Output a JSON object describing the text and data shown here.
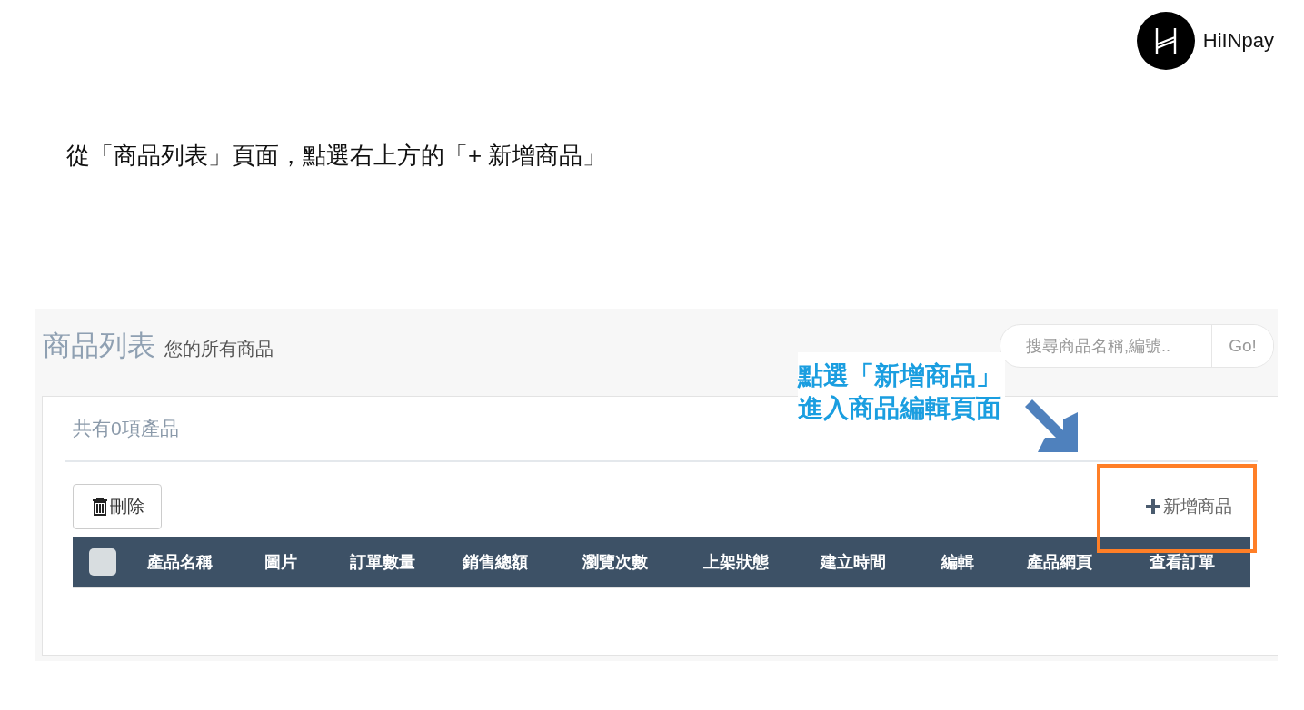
{
  "logo": {
    "text": "HiINpay"
  },
  "caption": "從「商品列表」頁面，點選右上方的「+ 新增商品」",
  "screenshot": {
    "title": "商品列表",
    "subtitle": "您的所有商品",
    "search": {
      "placeholder": "搜尋商品名稱,編號..",
      "button": "Go!"
    },
    "count": "共有0項產品",
    "delete_button": "刪除",
    "add_button": "新增商品",
    "table": {
      "select_all": {
        "checked": false
      },
      "columns": [
        "產品名稱",
        "圖片",
        "訂單數量",
        "銷售總額",
        "瀏覽次數",
        "上架狀態",
        "建立時間",
        "編輯",
        "產品網頁",
        "查看訂單"
      ]
    },
    "annotation": "點選「新增商品」進入商品編輯頁面"
  }
}
